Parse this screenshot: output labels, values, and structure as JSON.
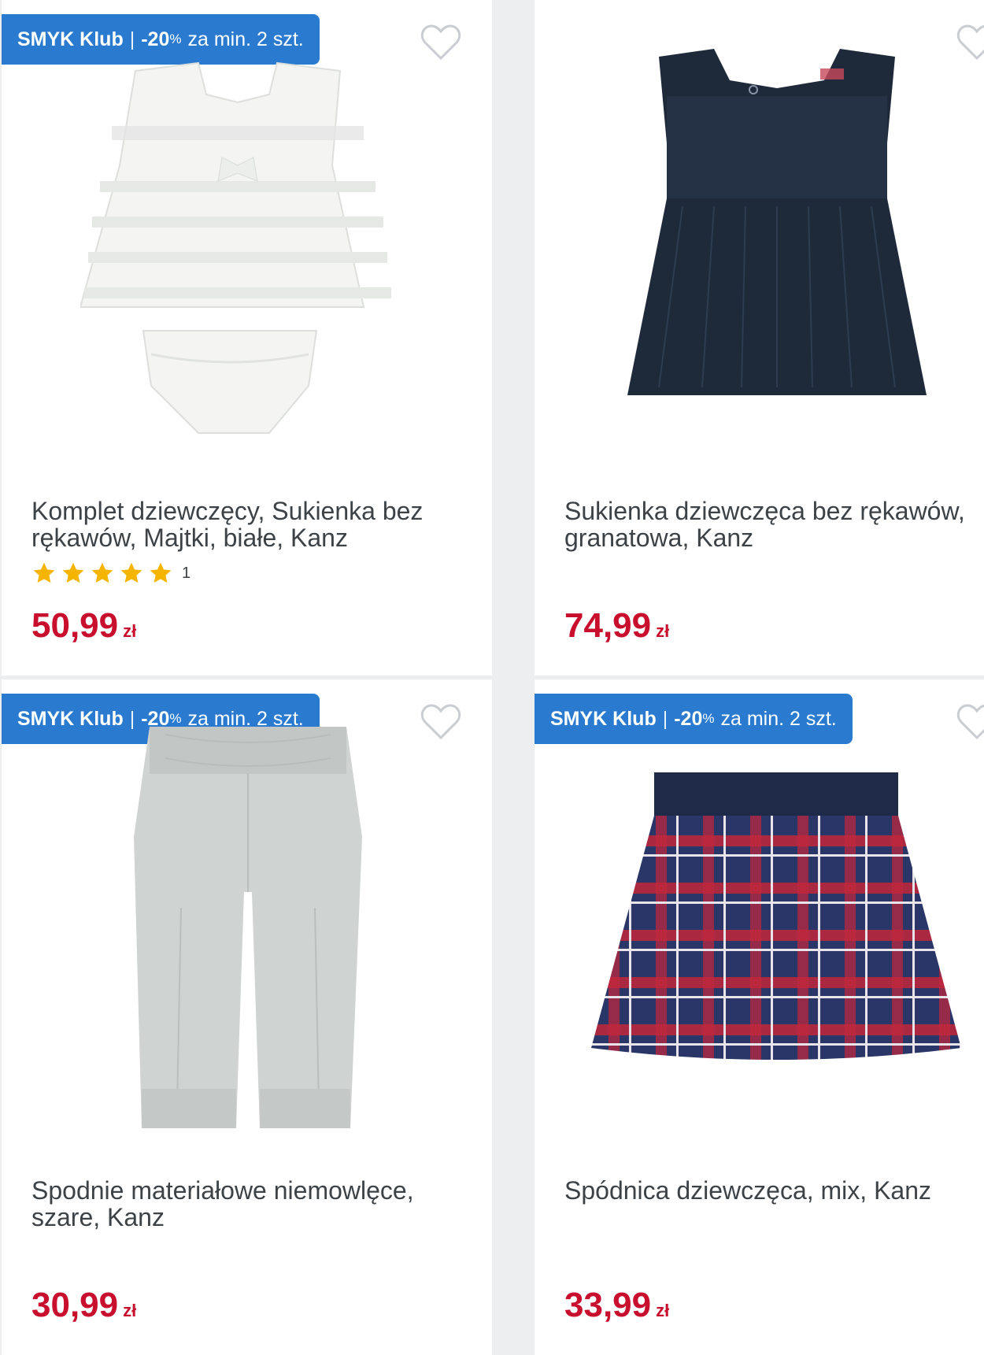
{
  "badge": {
    "brand": "SMYK Klub",
    "separator": "|",
    "discount": "-20",
    "percent": "%",
    "condition": "za min. 2 szt."
  },
  "currency": "zł",
  "products": [
    {
      "name_line1": "Komplet dziewczęcy, Sukienka bez",
      "name_line2": "rękawów, Majtki, białe, Kanz",
      "rating_count": "1",
      "rating_stars": 5,
      "price": "50,99",
      "has_badge": true
    },
    {
      "name_line1": "Sukienka dziewczęca bez rękawów,",
      "name_line2": "granatowa, Kanz",
      "price": "74,99",
      "has_badge": false
    },
    {
      "name_line1": "Spodnie materiałowe niemowlęce,",
      "name_line2": "szare, Kanz",
      "price": "30,99",
      "has_badge": true
    },
    {
      "name_line1": "Spódnica dziewczęca, mix, Kanz",
      "name_line2": "",
      "price": "33,99",
      "has_badge": true
    }
  ],
  "colors": {
    "badge_bg": "#2a7bd0",
    "price": "#c8102e",
    "star": "#f5b400",
    "heart_outline": "#c9ccd0"
  }
}
